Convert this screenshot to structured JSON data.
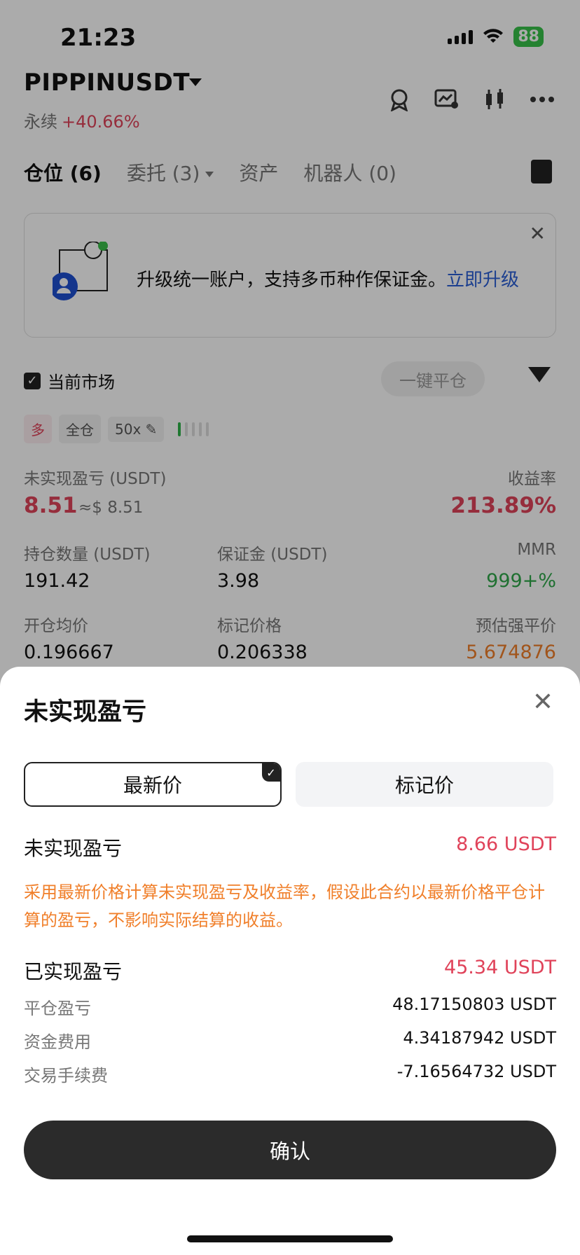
{
  "status_bar": {
    "time": "21:23",
    "battery": "88"
  },
  "header": {
    "symbol": "PIPPINUSDT",
    "contract_type": "永续",
    "change": "+40.66%"
  },
  "tabs": [
    {
      "label": "仓位 (6)"
    },
    {
      "label": "委托 (3)"
    },
    {
      "label": "资产"
    },
    {
      "label": "机器人 (0)"
    }
  ],
  "banner": {
    "text": "升级统一账户，支持多币种作保证金。",
    "link": "立即升级"
  },
  "filter": {
    "current_market": "当前市场",
    "close_all": "一键平仓"
  },
  "position_tags": {
    "side": "多",
    "margin_mode": "全仓",
    "leverage": "50x"
  },
  "position": {
    "unrealized_label": "未实现盈亏 (USDT)",
    "unrealized_value": "8.51",
    "unrealized_approx": "≈$ 8.51",
    "roe_label": "收益率",
    "roe_value": "213.89%",
    "size_label": "持仓数量 (USDT)",
    "size_value": "191.42",
    "margin_label": "保证金 (USDT)",
    "margin_value": "3.98",
    "mmr_label": "MMR",
    "mmr_value": "999+%",
    "entry_label": "开仓均价",
    "entry_value": "0.196667",
    "mark_label": "标记价格",
    "mark_value": "0.206338",
    "liq_label": "预估强平价",
    "liq_value": "5.674876"
  },
  "sheet": {
    "title": "未实现盈亏",
    "seg_latest": "最新价",
    "seg_mark": "标记价",
    "unrealized_label": "未实现盈亏",
    "unrealized_value": "8.66 USDT",
    "note": "采用最新价格计算未实现盈亏及收益率，假设此合约以最新价格平仓计算的盈亏，不影响实际结算的收益。",
    "realized_label": "已实现盈亏",
    "realized_value": "45.34 USDT",
    "close_pnl_label": "平仓盈亏",
    "close_pnl_value": "48.17150803 USDT",
    "funding_label": "资金费用",
    "funding_value": "4.34187942 USDT",
    "fee_label": "交易手续费",
    "fee_value": "-7.16564732 USDT",
    "confirm": "确认"
  }
}
